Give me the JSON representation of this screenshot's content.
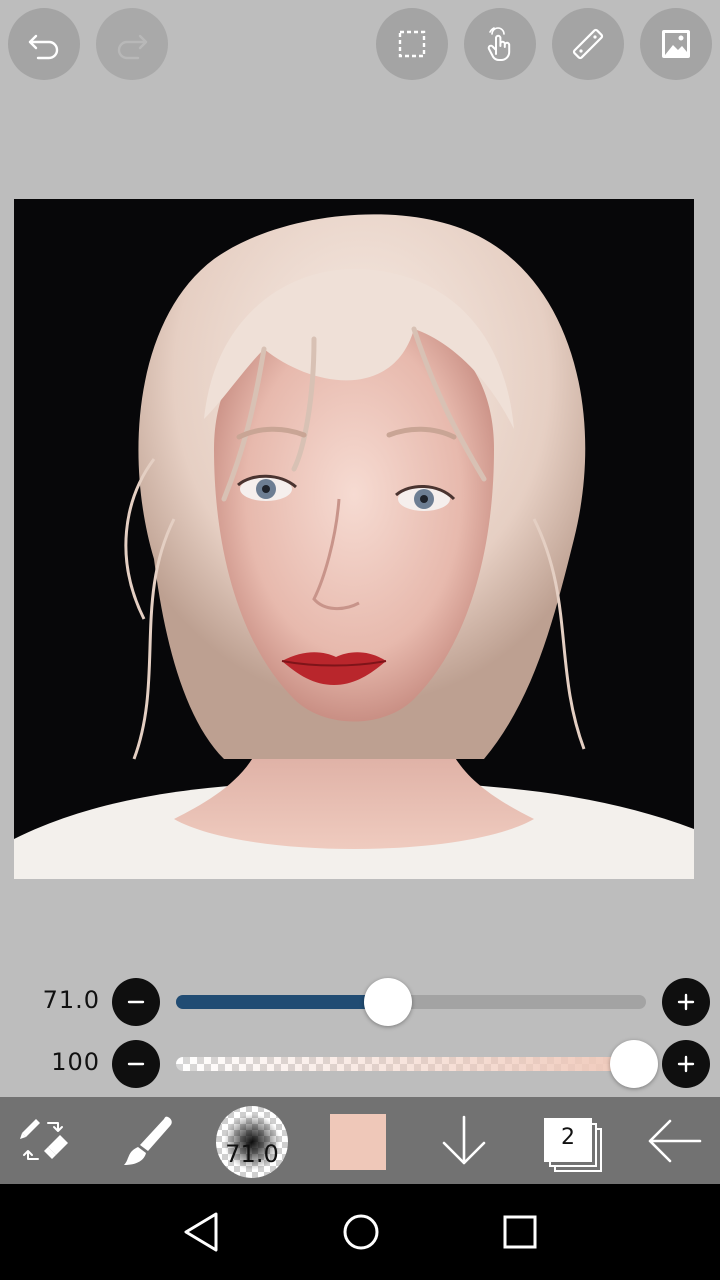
{
  "toolbar": {
    "undo_icon": "undo-icon",
    "redo_icon": "redo-icon",
    "selection_icon": "selection-icon",
    "hand_icon": "hand-icon",
    "ruler_icon": "ruler-icon",
    "image_icon": "image-icon"
  },
  "sliders": {
    "size": {
      "value_label": "71.0",
      "fraction": 0.45,
      "color": "#214c73"
    },
    "opacity": {
      "value_label": "100",
      "fraction": 1.0
    }
  },
  "bottom_tools": {
    "brush_size_label": "71.0",
    "current_color": "#efc8b9",
    "layer_count": "2"
  },
  "colors": {
    "app_background": "#bdbdbd",
    "bottom_bar": "#727272",
    "button_gray": "#a4a4a4"
  }
}
